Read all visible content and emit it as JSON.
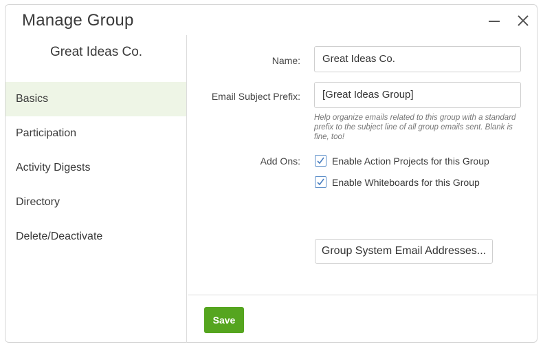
{
  "dialog": {
    "title": "Manage Group",
    "minimize_icon": "minimize-icon",
    "close_icon": "close-icon"
  },
  "sidebar": {
    "group_name": "Great Ideas Co.",
    "active_color": "#eef5e6",
    "items": [
      {
        "label": "Basics",
        "active": true
      },
      {
        "label": "Participation",
        "active": false
      },
      {
        "label": "Activity Digests",
        "active": false
      },
      {
        "label": "Directory",
        "active": false
      },
      {
        "label": "Delete/Deactivate",
        "active": false
      }
    ]
  },
  "form": {
    "name_label": "Name:",
    "name_value": "Great Ideas Co.",
    "prefix_label": "Email Subject Prefix:",
    "prefix_value": "[Great Ideas Group]",
    "prefix_help": "Help organize emails related to this group with a standard prefix to the subject line of all group emails sent. Blank is fine, too!",
    "addons_label": "Add Ons:",
    "addons": [
      {
        "label": "Enable Action Projects for this Group",
        "checked": true
      },
      {
        "label": "Enable Whiteboards for this Group",
        "checked": true
      }
    ],
    "system_email_button": "Group System Email Addresses..."
  },
  "footer": {
    "save_label": "Save",
    "save_color": "#55a51f"
  }
}
